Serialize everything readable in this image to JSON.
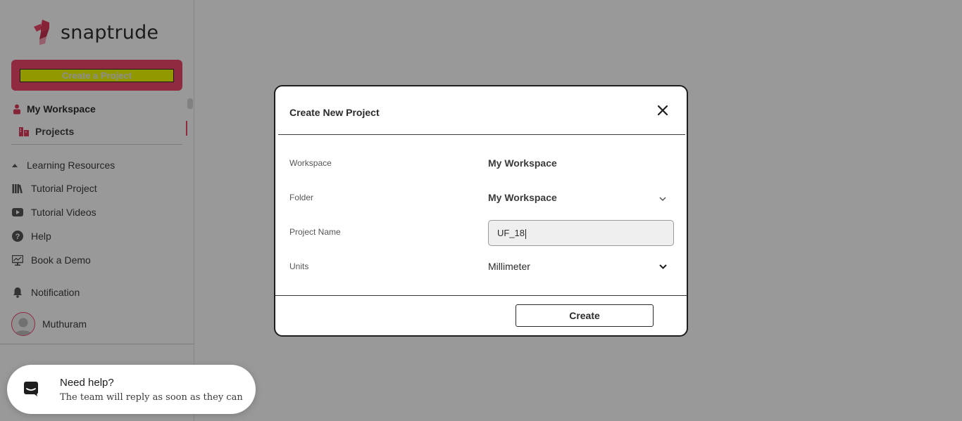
{
  "app": {
    "brand": "snaptrude",
    "brand_color": "#f0466c"
  },
  "sidebar": {
    "create_project_label": "Create a Project",
    "workspace_label": "My Workspace",
    "projects_label": "Projects",
    "learning_resources_label": "Learning Resources",
    "items": [
      {
        "label": "Tutorial Project",
        "icon": "library-icon"
      },
      {
        "label": "Tutorial Videos",
        "icon": "video-icon"
      },
      {
        "label": "Help",
        "icon": "help-icon"
      },
      {
        "label": "Book a Demo",
        "icon": "presentation-icon"
      }
    ],
    "notification_label": "Notification",
    "user_name": "Muthuram"
  },
  "modal": {
    "title": "Create New Project",
    "workspace": {
      "label": "Workspace",
      "value": "My Workspace"
    },
    "folder": {
      "label": "Folder",
      "value": "My Workspace"
    },
    "project_name": {
      "label": "Project Name",
      "value": "UF_18"
    },
    "units": {
      "label": "Units",
      "value": "Millimeter"
    },
    "create_label": "Create"
  },
  "help_widget": {
    "title": "Need help?",
    "subtitle": "The team will reply as soon as they can"
  }
}
